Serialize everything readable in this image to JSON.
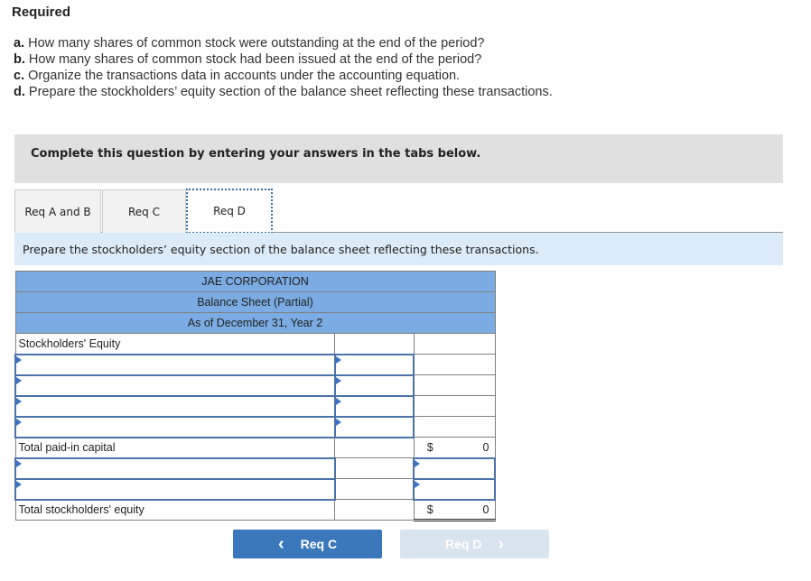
{
  "required": {
    "title": "Required",
    "items": [
      {
        "letter": "a.",
        "text": " How many shares of common stock were outstanding at the end of the period?"
      },
      {
        "letter": "b.",
        "text": " How many shares of common stock had been issued at the end of the period?"
      },
      {
        "letter": "c.",
        "text": " Organize the transactions data in accounts under the accounting equation."
      },
      {
        "letter": "d.",
        "text": " Prepare the stockholders’ equity section of the balance sheet reflecting these transactions."
      }
    ]
  },
  "instruction": "Complete this question by entering your answers in the tabs below.",
  "tabs": [
    {
      "label": "Req A and B",
      "active": false
    },
    {
      "label": "Req C",
      "active": false
    },
    {
      "label": "Req D",
      "active": true
    }
  ],
  "prompt": "Prepare the stockholders’ equity section of the balance sheet reflecting these transactions.",
  "balance_sheet": {
    "company": "JAE CORPORATION",
    "statement": "Balance Sheet (Partial)",
    "date": "As of December 31, Year 2",
    "section_label": "Stockholders' Equity",
    "total_paid_in_label": "Total paid-in capital",
    "total_paid_in_currency": "$",
    "total_paid_in_value": "0",
    "total_equity_label": "Total stockholders' equity",
    "total_equity_currency": "$",
    "total_equity_value": "0"
  },
  "nav": {
    "prev_label": "Req C",
    "prev_icon": "‹",
    "next_label": "Req D",
    "next_icon": "›"
  }
}
